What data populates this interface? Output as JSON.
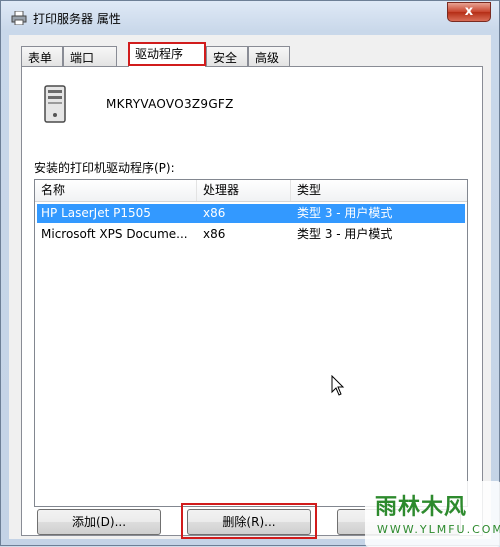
{
  "window": {
    "title": "打印服务器 属性",
    "close_glyph": "x"
  },
  "tabs": [
    {
      "label": "表单",
      "active": false
    },
    {
      "label": "端口",
      "active": false
    },
    {
      "label": "驱动程序",
      "active": true
    },
    {
      "label": "安全",
      "active": false
    },
    {
      "label": "高级",
      "active": false
    }
  ],
  "server": {
    "name": "MKRYVAOVO3Z9GFZ",
    "icon": "computer-tower-icon"
  },
  "drivers": {
    "label": "安装的打印机驱动程序(P):",
    "columns": [
      "名称",
      "处理器",
      "类型"
    ],
    "rows": [
      {
        "name": "HP LaserJet P1505",
        "processor": "x86",
        "type": "类型 3 - 用户模式",
        "selected": true
      },
      {
        "name": "Microsoft XPS Docume...",
        "processor": "x86",
        "type": "类型 3 - 用户模式",
        "selected": false
      }
    ]
  },
  "buttons": {
    "add": "添加(D)...",
    "remove": "删除(R)..."
  },
  "watermark": {
    "text": "雨林木风",
    "url": "WWW.YLMFU.COM"
  },
  "colors": {
    "selection": "#3399ff",
    "highlight_annotation": "#d11c1c"
  }
}
